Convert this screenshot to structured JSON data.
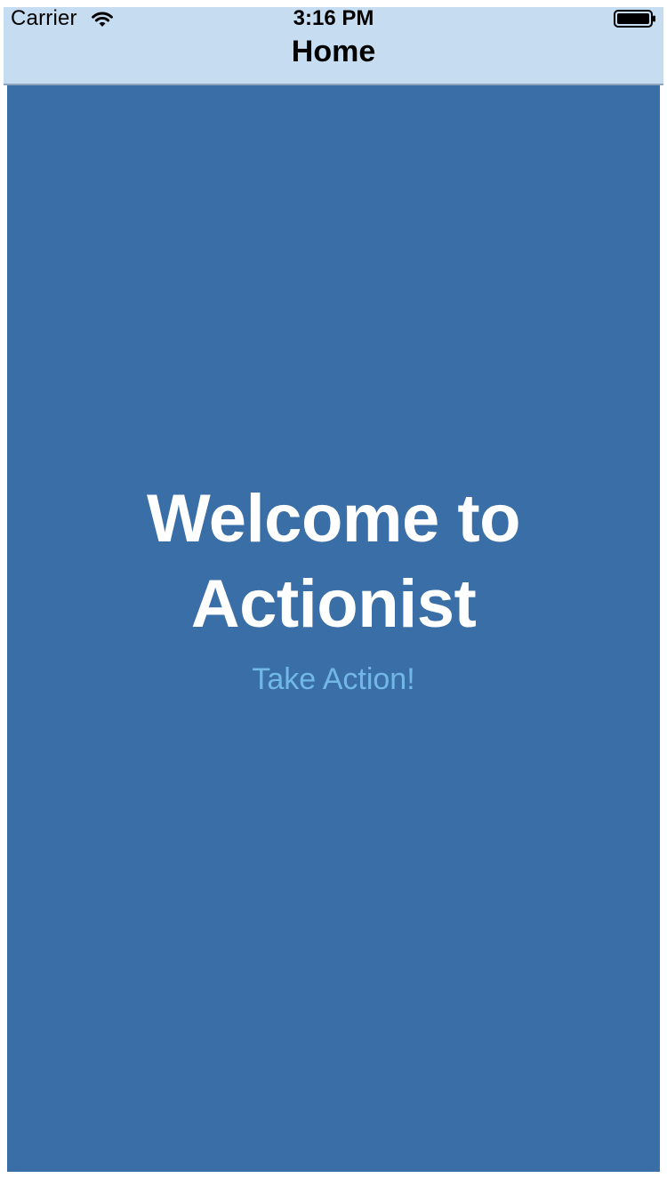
{
  "status_bar": {
    "carrier": "Carrier",
    "time": "3:16 PM",
    "wifi_icon": "wifi-icon",
    "battery_icon": "battery-icon"
  },
  "nav_bar": {
    "title": "Home",
    "background": "#c6dcf0"
  },
  "main": {
    "welcome_line1": "Welcome to",
    "welcome_line2": "Actionist",
    "action_label": "Take Action!",
    "background": "#3a6ea7",
    "heading_color": "#ffffff",
    "link_color": "#72b8e6"
  }
}
